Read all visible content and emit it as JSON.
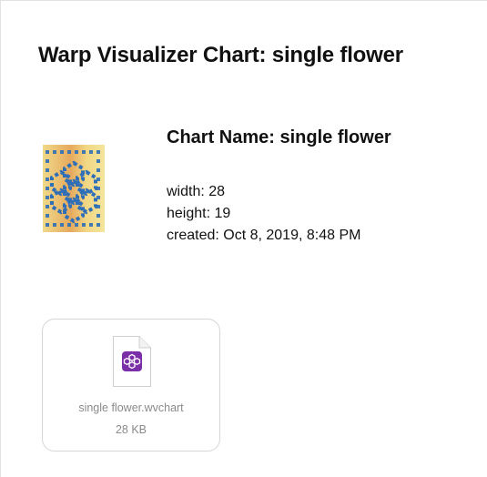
{
  "page": {
    "title": "Warp Visualizer Chart: single flower"
  },
  "chart_info": {
    "heading": "Chart Name: single flower",
    "width_text": "width: 28",
    "height_text": "height: 19",
    "created_text": "created: Oct 8, 2019, 8:48 PM"
  },
  "attachment": {
    "file_name": "single flower.wvchart",
    "file_size": "28 KB",
    "icon": "wvchart-file-icon"
  },
  "colors": {
    "thumb_blue": "#2f6fb8",
    "thumb_gold": "#e9b96a",
    "file_icon_purple": "#7a2fa8"
  }
}
